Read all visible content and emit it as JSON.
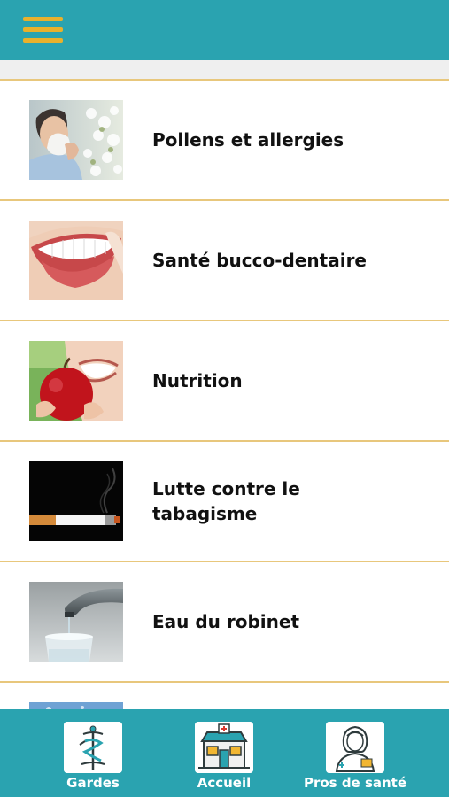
{
  "header": {
    "menu_icon": "hamburger-menu-icon"
  },
  "list": {
    "items": [
      {
        "label": "Pollens et allergies",
        "image": "person-sneezing-photo"
      },
      {
        "label": "Santé bucco-dentaire",
        "image": "smiling-teeth-photo"
      },
      {
        "label": "Nutrition",
        "image": "apple-bite-photo"
      },
      {
        "label": "Lutte contre le\ntabagisme",
        "image": "cigarette-smoke-photo"
      },
      {
        "label": "Eau du robinet",
        "image": "tap-water-photo"
      }
    ]
  },
  "bottom_nav": {
    "items": [
      {
        "label": "Gardes",
        "icon": "caduceus-icon"
      },
      {
        "label": "Accueil",
        "icon": "pharmacy-storefront-icon"
      },
      {
        "label": "Pros de santé",
        "icon": "nurse-icon"
      }
    ]
  },
  "colors": {
    "primary": "#2aa3b0",
    "accent": "#e9b12c",
    "divider": "#e8c77c"
  }
}
